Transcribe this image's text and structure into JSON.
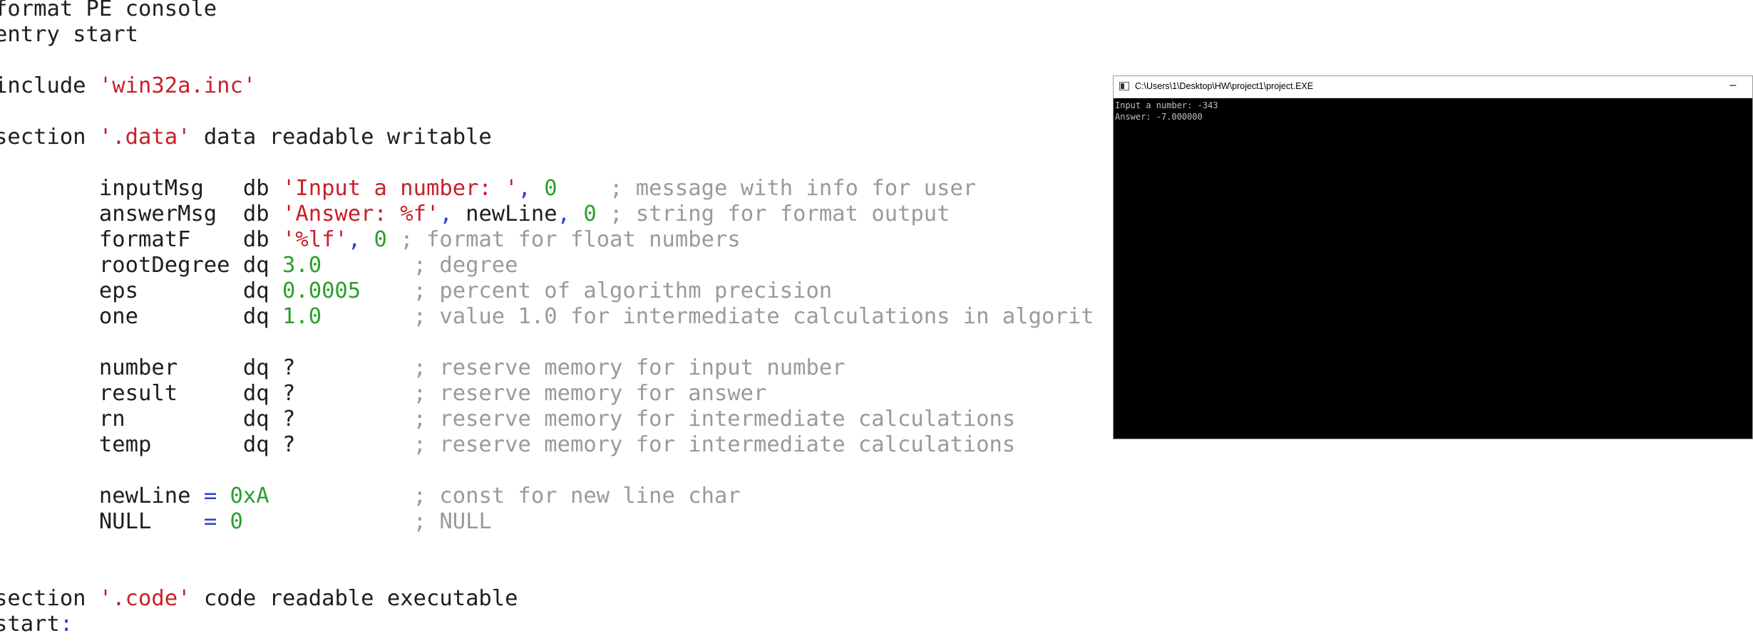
{
  "editor": {
    "lines": [
      [
        {
          "t": "format PE console",
          "k": "plain"
        }
      ],
      [
        {
          "t": "entry start",
          "k": "plain"
        }
      ],
      [],
      [
        {
          "t": "include ",
          "k": "plain"
        },
        {
          "t": "'win32a.inc'",
          "k": "string"
        }
      ],
      [],
      [
        {
          "t": "section ",
          "k": "plain"
        },
        {
          "t": "'.data'",
          "k": "string"
        },
        {
          "t": " data readable writable",
          "k": "plain"
        }
      ],
      [],
      [
        {
          "t": "        inputMsg   db ",
          "k": "plain"
        },
        {
          "t": "'Input a number: '",
          "k": "string"
        },
        {
          "t": ",",
          "k": "punct"
        },
        {
          "t": " 0",
          "k": "number"
        },
        {
          "t": "    ; message with info for user",
          "k": "comment"
        }
      ],
      [
        {
          "t": "        answerMsg  db ",
          "k": "plain"
        },
        {
          "t": "'Answer: %f'",
          "k": "string"
        },
        {
          "t": ",",
          "k": "punct"
        },
        {
          "t": " newLine",
          "k": "plain"
        },
        {
          "t": ",",
          "k": "punct"
        },
        {
          "t": " 0",
          "k": "number"
        },
        {
          "t": " ; string for format output",
          "k": "comment"
        }
      ],
      [
        {
          "t": "        formatF    db ",
          "k": "plain"
        },
        {
          "t": "'%lf'",
          "k": "string"
        },
        {
          "t": ",",
          "k": "punct"
        },
        {
          "t": " 0",
          "k": "number"
        },
        {
          "t": " ; format for float numbers",
          "k": "comment"
        }
      ],
      [
        {
          "t": "        rootDegree dq ",
          "k": "plain"
        },
        {
          "t": "3.0",
          "k": "number"
        },
        {
          "t": "       ; degree",
          "k": "comment"
        }
      ],
      [
        {
          "t": "        eps        dq ",
          "k": "plain"
        },
        {
          "t": "0.0005",
          "k": "number"
        },
        {
          "t": "    ; percent of algorithm precision",
          "k": "comment"
        }
      ],
      [
        {
          "t": "        one        dq ",
          "k": "plain"
        },
        {
          "t": "1.0",
          "k": "number"
        },
        {
          "t": "       ; value 1.0 for intermediate calculations in algorit",
          "k": "comment"
        }
      ],
      [],
      [
        {
          "t": "        number     dq ?",
          "k": "plain"
        },
        {
          "t": "         ; reserve memory for input number",
          "k": "comment"
        }
      ],
      [
        {
          "t": "        result     dq ?",
          "k": "plain"
        },
        {
          "t": "         ; reserve memory for answer",
          "k": "comment"
        }
      ],
      [
        {
          "t": "        rn         dq ?",
          "k": "plain"
        },
        {
          "t": "         ; reserve memory for intermediate calculations",
          "k": "comment"
        }
      ],
      [
        {
          "t": "        temp       dq ?",
          "k": "plain"
        },
        {
          "t": "         ; reserve memory for intermediate calculations",
          "k": "comment"
        }
      ],
      [],
      [
        {
          "t": "        newLine ",
          "k": "plain"
        },
        {
          "t": "=",
          "k": "punct"
        },
        {
          "t": " 0xA",
          "k": "number"
        },
        {
          "t": "           ; const for new line char",
          "k": "comment"
        }
      ],
      [
        {
          "t": "        NULL    ",
          "k": "plain"
        },
        {
          "t": "=",
          "k": "punct"
        },
        {
          "t": " 0",
          "k": "number"
        },
        {
          "t": "             ; NULL",
          "k": "comment"
        }
      ],
      [],
      [],
      [
        {
          "t": "section ",
          "k": "plain"
        },
        {
          "t": "'.code'",
          "k": "string"
        },
        {
          "t": " code readable executable",
          "k": "plain"
        }
      ],
      [
        {
          "t": "start",
          "k": "plain"
        },
        {
          "t": ":",
          "k": "label"
        }
      ]
    ]
  },
  "console": {
    "title": "C:\\Users\\1\\Desktop\\HW\\project1\\project.EXE",
    "minimize_glyph": "–",
    "output": [
      "Input a number: -343",
      "Answer: -7.000000"
    ]
  },
  "colors": {
    "string": "#c8202a",
    "number": "#2aa02a",
    "comment": "#9a9a9a",
    "punct": "#2c3fd0",
    "console_bg": "#000000",
    "console_text": "#c0c0c0"
  },
  "icons": {
    "console_app": "console-app-icon",
    "minimize": "minimize-icon"
  }
}
